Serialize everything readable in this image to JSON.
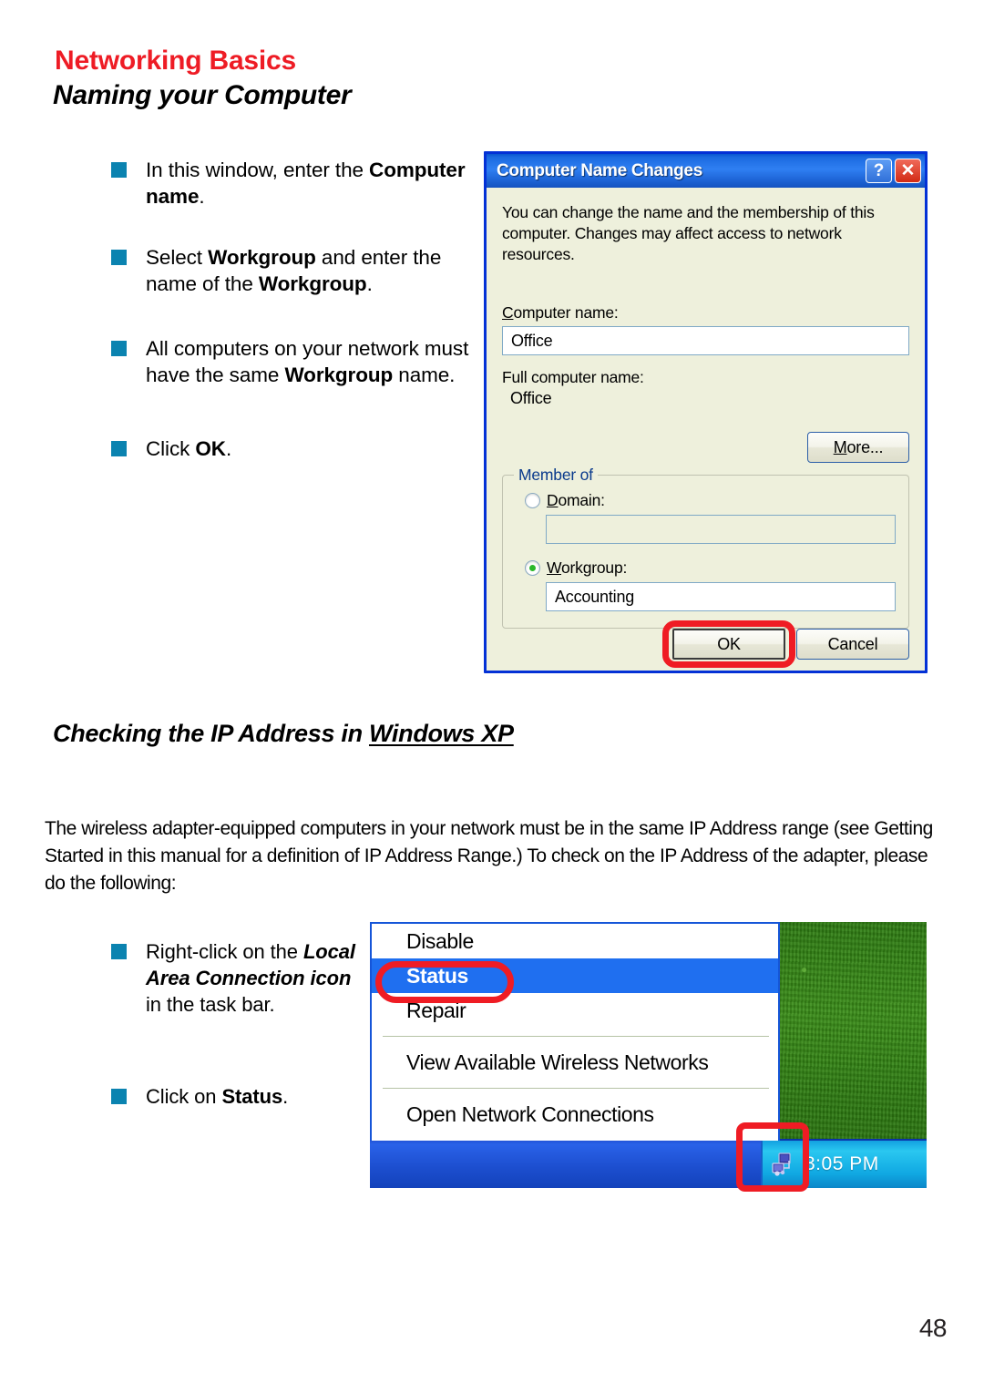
{
  "header": {
    "section_title": "Networking Basics",
    "page_heading": "Naming your Computer",
    "accent_color": "#ee1c25",
    "bullet_color": "#0b83b0"
  },
  "top_bullets": [
    {
      "prefix": "In this window, enter the ",
      "bold": "Computer name",
      "suffix": "."
    },
    {
      "prefix": "Select ",
      "bold": "Workgroup",
      "mid": " and enter the name of the ",
      "bold2": "Workgroup",
      "suffix": "."
    },
    {
      "prefix": "All computers on your network must have the same ",
      "bold": "Workgroup",
      "suffix": " name."
    },
    {
      "prefix": "Click ",
      "bold": "OK",
      "suffix": "."
    }
  ],
  "dialog": {
    "title": "Computer Name Changes",
    "help_button": "?",
    "close_button": "✕",
    "description": "You can change the name and the membership of this computer. Changes may affect access to network resources.",
    "computer_name_label": "Computer name:",
    "computer_name_value": "Office",
    "full_computer_name_label": "Full computer name:",
    "full_computer_name_value": "Office",
    "more_button": "More...",
    "groupbox_legend": "Member of",
    "domain_label": "Domain:",
    "domain_value": "",
    "domain_selected": false,
    "workgroup_label": "Workgroup:",
    "workgroup_value": "Accounting",
    "workgroup_selected": true,
    "ok_button": "OK",
    "cancel_button": "Cancel",
    "highlight_color": "#ef1c24",
    "titlebar_color": "#2f7ff2",
    "body_color": "#eef0dc"
  },
  "section2": {
    "heading_plain": "Checking the IP Address in ",
    "heading_underlined": "Windows XP",
    "paragraph": "The wireless adapter-equipped computers in your network must be in the same IP Address range (see Getting Started in this manual for a definition of IP Address Range.)  To check on the IP Address of the adapter, please do the following:"
  },
  "bottom_bullets": [
    {
      "prefix": "Right-click on the ",
      "italic": "Local Area Connection icon",
      "suffix": " in the task bar."
    },
    {
      "prefix": "Click on ",
      "bold": "Status",
      "suffix": "."
    }
  ],
  "context_menu": {
    "items": [
      {
        "label": "Disable",
        "selected": false,
        "separator_after": false
      },
      {
        "label": "Status",
        "selected": true,
        "separator_after": false
      },
      {
        "label": "Repair",
        "selected": false,
        "separator_after": true
      },
      {
        "label": "View Available Wireless Networks",
        "selected": false,
        "separator_after": true
      },
      {
        "label": "Open Network Connections",
        "selected": false,
        "separator_after": false
      }
    ],
    "selection_color": "#1f6ff0",
    "highlight_color": "#ef1c24"
  },
  "taskbar": {
    "clock": "3:05 PM",
    "tray_icon": "network-connection-icon",
    "taskbar_color": "#2254d8",
    "tray_color": "#2ac7f0"
  },
  "footer": {
    "page_number": "48"
  }
}
